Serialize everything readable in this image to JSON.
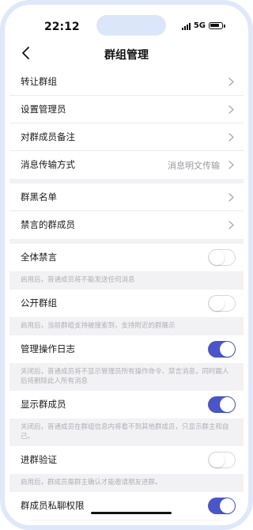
{
  "status": {
    "time": "22:12",
    "network": "5G"
  },
  "nav": {
    "title": "群组管理"
  },
  "groups": [
    {
      "rows": [
        {
          "label": "转让群组",
          "type": "link"
        },
        {
          "label": "设置管理员",
          "type": "link"
        },
        {
          "label": "对群成员备注",
          "type": "link"
        },
        {
          "label": "消息传输方式",
          "type": "link",
          "value": "消息明文传输"
        }
      ]
    },
    {
      "rows": [
        {
          "label": "群黑名单",
          "type": "link"
        },
        {
          "label": "禁言的群成员",
          "type": "link"
        }
      ]
    }
  ],
  "toggles": [
    {
      "label": "全体禁言",
      "on": false,
      "note": "启用后，普通成员将不能发送任何消息"
    },
    {
      "label": "公开群组",
      "on": false,
      "note": "启用后，当前群组支持被搜索到，支持附近的群展示"
    },
    {
      "label": "管理操作日志",
      "on": true,
      "note": "关闭后，普通成员将不显示管理员所有操作命令、禁言消息，同时踢人后将删除此人所有消息"
    },
    {
      "label": "显示群成员",
      "on": true,
      "note": "关闭后，普通成员在群组信息内将看不到其他群成员，只显示群主和自己。"
    },
    {
      "label": "进群验证",
      "on": false,
      "note": "启用后，群成员需群主确认才能邀请朋友进群。"
    },
    {
      "label": "群成员私聊权限",
      "on": true,
      "note": ""
    }
  ],
  "colors": {
    "accent": "#4a55c8",
    "background": "#f2f2f4"
  },
  "icons": {
    "back": "chevron-left-icon",
    "row_arrow": "chevron-right-icon"
  }
}
